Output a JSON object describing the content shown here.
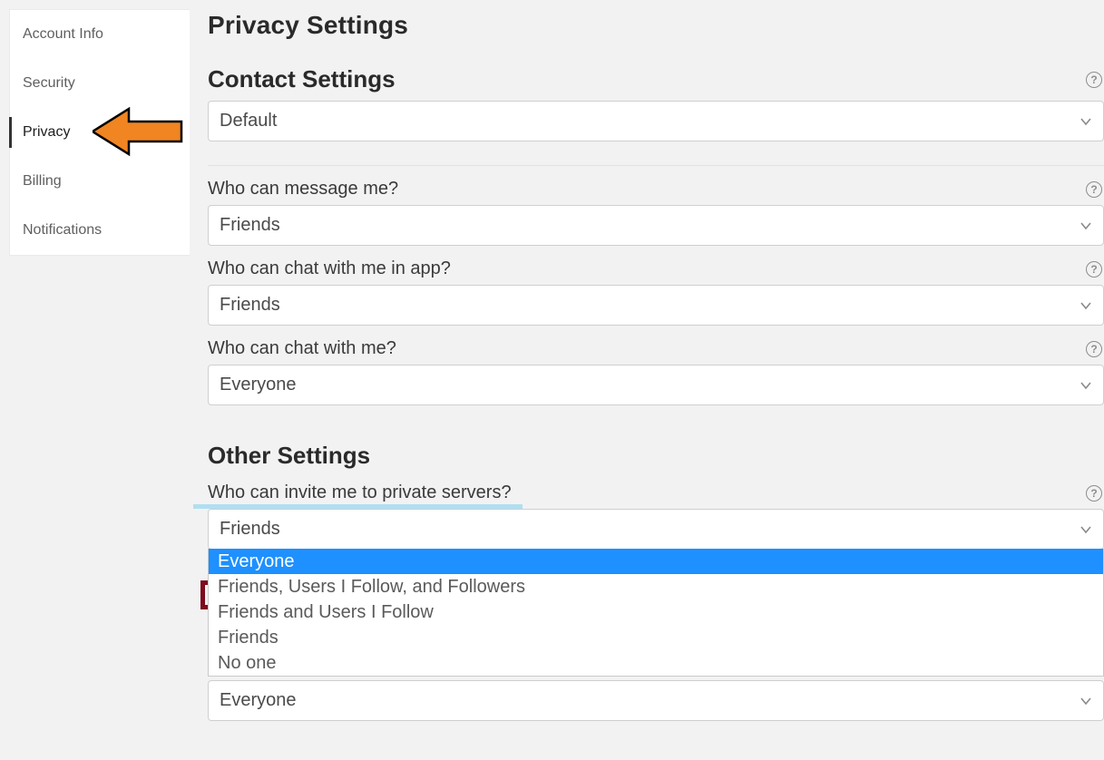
{
  "sidebar": {
    "items": [
      {
        "label": "Account Info"
      },
      {
        "label": "Security"
      },
      {
        "label": "Privacy"
      },
      {
        "label": "Billing"
      },
      {
        "label": "Notifications"
      }
    ]
  },
  "page": {
    "title": "Privacy Settings"
  },
  "contact_section": {
    "title": "Contact Settings",
    "default_select": "Default",
    "fields": [
      {
        "label": "Who can message me?",
        "value": "Friends"
      },
      {
        "label": "Who can chat with me in app?",
        "value": "Friends"
      },
      {
        "label": "Who can chat with me?",
        "value": "Everyone"
      }
    ]
  },
  "other_section": {
    "title": "Other Settings",
    "invite_field": {
      "label": "Who can invite me to private servers?",
      "value": "Friends",
      "options": [
        "Everyone",
        "Friends, Users I Follow, and Followers",
        "Friends and Users I Follow",
        "Friends",
        "No one"
      ],
      "highlighted_option_index": 0
    },
    "inventory_field": {
      "value": "Everyone"
    }
  },
  "help_glyph": "?"
}
